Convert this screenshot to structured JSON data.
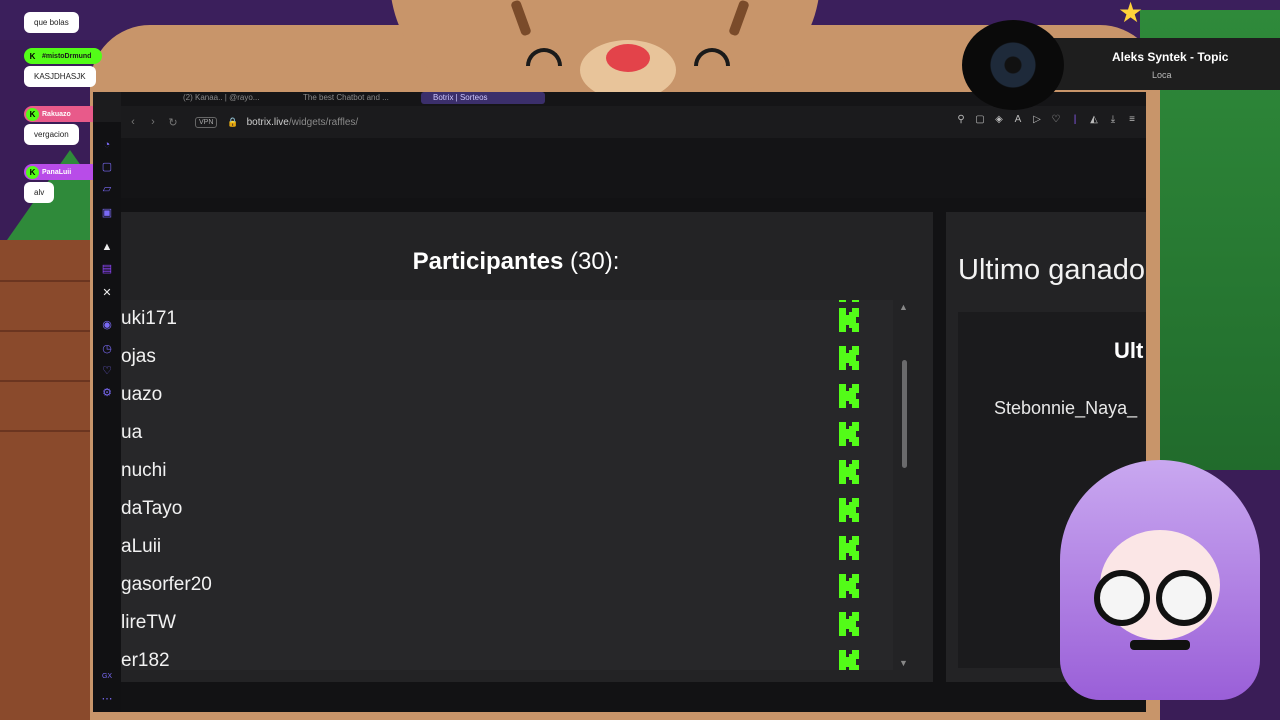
{
  "chat": [
    {
      "user": "",
      "message": "que bolas",
      "color": "#53fc18"
    },
    {
      "user": "#mistoDrmund",
      "message": "KASJDHASJK",
      "color": "#53fc18"
    },
    {
      "user": "Rakuazo",
      "message": "vergacion",
      "color": "#e85a8a"
    },
    {
      "user": "PanaLuii",
      "message": "alv",
      "color": "#b84ce8"
    }
  ],
  "browser": {
    "tabs": [
      "(2) Kanaa.. | @rayo...",
      "The best Chatbot and ...",
      "Botrix | Sorteos"
    ],
    "vpn_label": "VPN",
    "url_host": "botrix.live",
    "url_path": "/widgets/raffles/",
    "sidebar_icons": [
      "history-icon",
      "bag-icon",
      "chat-icon",
      "messenger-icon",
      "aria-icon",
      "twitch-icon",
      "x-icon",
      "player-icon",
      "clock-icon",
      "heart-icon",
      "settings-icon",
      "gx-icon",
      "more-icon"
    ],
    "toolbar_icons": [
      "pin-icon",
      "snapshot-icon",
      "shield-icon",
      "translate-icon",
      "play-icon",
      "heart-icon",
      "profile-icon",
      "download-icon",
      "menu-icon"
    ]
  },
  "raffle": {
    "participants_label": "Participantes",
    "participants_count": "(30):",
    "participants": [
      "uki171",
      "ojas",
      "uazo",
      "ua",
      "nuchi",
      "daTayo",
      "aLuii",
      "gasorfer20",
      "lireTW",
      "er182"
    ],
    "platform_icon": "kick-icon",
    "kick_color": "#53fc18",
    "winner_title": "Ultimo ganado",
    "winner_heading": "Ult",
    "winner_name": "Stebonnie_Naya_"
  },
  "music": {
    "title": "Aleks Syntek - Topic",
    "artist": "Loca"
  },
  "colors": {
    "accent": "#7a6af5",
    "kick": "#53fc18",
    "background": "#1c1c1e"
  }
}
